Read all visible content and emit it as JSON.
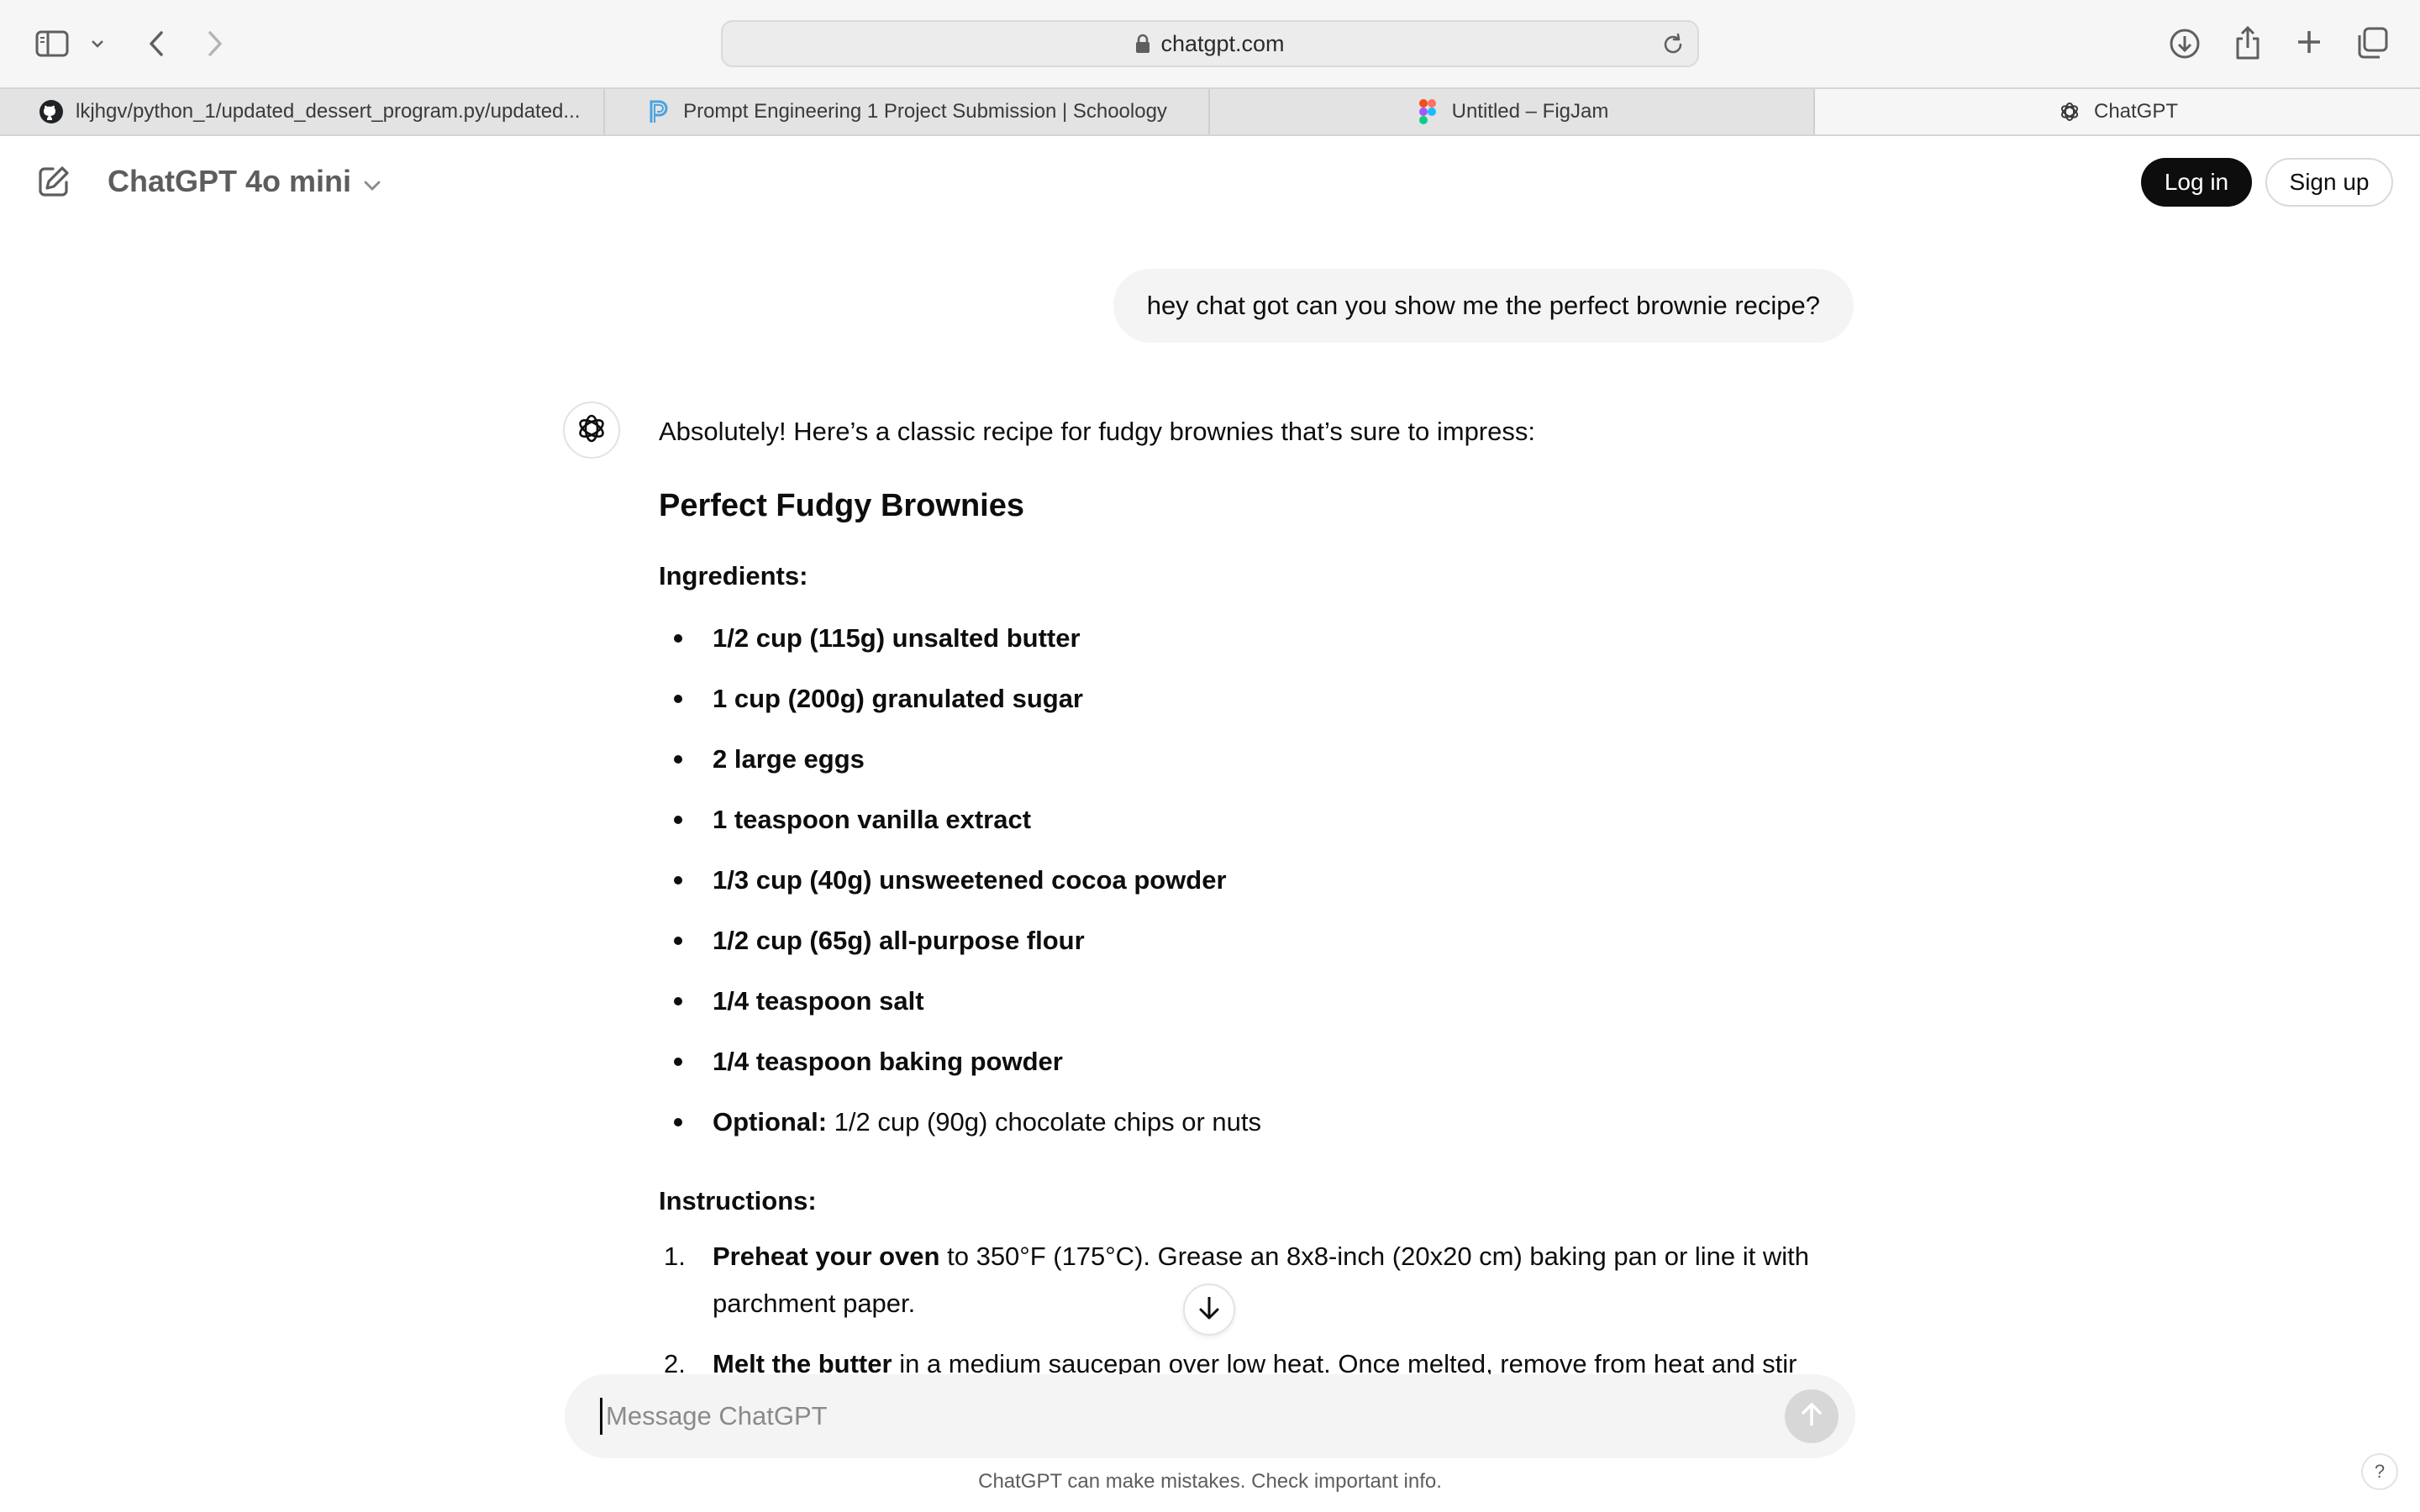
{
  "browser": {
    "url": "chatgpt.com",
    "tabs": [
      {
        "title": "lkjhgv/python_1/updated_dessert_program.py/updated...",
        "icon": "github-icon",
        "active": false
      },
      {
        "title": "Prompt Engineering 1 Project Submission | Schoology",
        "icon": "schoology-icon",
        "active": false
      },
      {
        "title": "Untitled – FigJam",
        "icon": "figma-icon",
        "active": false
      },
      {
        "title": "ChatGPT",
        "icon": "openai-icon",
        "active": true
      }
    ]
  },
  "header": {
    "model_name": "ChatGPT 4o mini",
    "login_label": "Log in",
    "signup_label": "Sign up"
  },
  "conversation": {
    "user_message": "hey chat got can you show me the perfect brownie recipe?",
    "assistant": {
      "intro": "Absolutely! Here’s a classic recipe for fudgy brownies that’s sure to impress:",
      "title": "Perfect Fudgy Brownies",
      "ingredients_label": "Ingredients:",
      "ingredients": [
        "1/2 cup (115g) unsalted butter",
        "1 cup (200g) granulated sugar",
        "2 large eggs",
        "1 teaspoon vanilla extract",
        "1/3 cup (40g) unsweetened cocoa powder",
        "1/2 cup (65g) all-purpose flour",
        "1/4 teaspoon salt",
        "1/4 teaspoon baking powder"
      ],
      "optional": {
        "label": "Optional:",
        "text": "1/2 cup (90g) chocolate chips or nuts"
      },
      "instructions_label": "Instructions:",
      "instructions": [
        {
          "num": "1.",
          "bold": "Preheat your oven",
          "text": "to 350°F (175°C). Grease an 8x8-inch (20x20 cm) baking pan or line it with parchment paper."
        },
        {
          "num": "2.",
          "bold": "Melt the butter",
          "text": "in a medium saucepan over low heat. Once melted, remove from heat and stir"
        }
      ]
    }
  },
  "composer": {
    "placeholder": "Message ChatGPT"
  },
  "footer": {
    "disclaimer": "ChatGPT can make mistakes. Check important info.",
    "help_label": "?"
  }
}
